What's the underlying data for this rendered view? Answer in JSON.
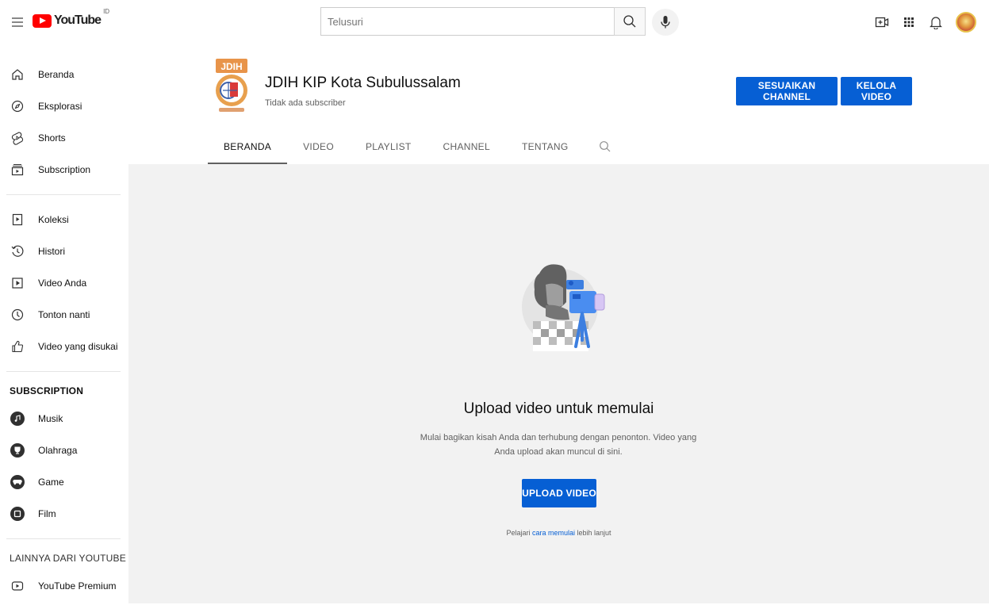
{
  "header": {
    "logo_text": "YouTube",
    "logo_country": "ID",
    "search_placeholder": "Telusuri"
  },
  "sidebar": {
    "main_items": [
      {
        "label": "Beranda",
        "icon": "home-icon"
      },
      {
        "label": "Eksplorasi",
        "icon": "compass-icon"
      },
      {
        "label": "Shorts",
        "icon": "shorts-icon"
      },
      {
        "label": "Subscription",
        "icon": "subscriptions-icon"
      }
    ],
    "library_items": [
      {
        "label": "Koleksi",
        "icon": "library-icon"
      },
      {
        "label": "Histori",
        "icon": "history-icon"
      },
      {
        "label": "Video Anda",
        "icon": "your-videos-icon"
      },
      {
        "label": "Tonton nanti",
        "icon": "watch-later-icon"
      },
      {
        "label": "Video yang disukai",
        "icon": "thumbs-up-icon"
      }
    ],
    "subscription_title": "SUBSCRIPTION",
    "subscriptions": [
      {
        "label": "Musik",
        "icon": "music-icon"
      },
      {
        "label": "Olahraga",
        "icon": "sports-icon"
      },
      {
        "label": "Game",
        "icon": "gaming-icon"
      },
      {
        "label": "Film",
        "icon": "film-icon"
      }
    ],
    "more_title": "LAINNYA DARI YOUTUBE",
    "more_items": [
      {
        "label": "YouTube Premium",
        "icon": "youtube-premium-icon"
      }
    ]
  },
  "channel": {
    "name": "JDIH KIP Kota Subulussalam",
    "subscribers": "Tidak ada subscriber",
    "customize_label": "SESUAIKAN CHANNEL",
    "manage_label": "KELOLA VIDEO",
    "tabs": [
      "BERANDA",
      "VIDEO",
      "PLAYLIST",
      "CHANNEL",
      "TENTANG"
    ],
    "active_tab": "BERANDA"
  },
  "empty_state": {
    "title": "Upload video untuk memulai",
    "description": "Mulai bagikan kisah Anda dan terhubung dengan penonton. Video yang Anda upload akan muncul di sini.",
    "upload_label": "UPLOAD VIDEO",
    "learn_prefix": "Pelajari ",
    "learn_link": "cara memulai",
    "learn_suffix": " lebih lanjut"
  },
  "colors": {
    "brand_red": "#ff0000",
    "accent_blue": "#065fd4",
    "content_bg": "#f2f2f2"
  }
}
